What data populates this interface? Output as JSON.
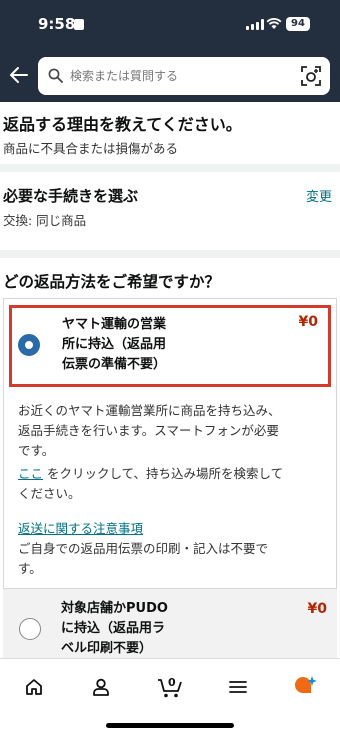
{
  "status_bar": {
    "time": "9:58",
    "battery": "94"
  },
  "search": {
    "placeholder": "検索または質問する"
  },
  "return_reason": {
    "title": "返品する理由を教えてください。",
    "value": "商品に不具合または損傷がある"
  },
  "procedure": {
    "title": "必要な手続きを選ぶ",
    "change_label": "変更",
    "value": "交換: 同じ商品"
  },
  "return_method": {
    "title": "どの返品方法をご希望ですか？",
    "options": [
      {
        "label": "ヤマト運輸の営業所に持込（返品用伝票の準備不要）",
        "label_lines": [
          "ヤマト運輸の営業",
          "所に持込（返品用",
          "伝票の準備不要）"
        ],
        "price": "¥0",
        "selected": true,
        "description": "お近くのヤマト運輸営業所に商品を持ち込み、返品手続きを行います。スマートフォンが必要です。",
        "description_lines": [
          "お近くのヤマト運輸営業所に商品を持ち込み、",
          "返品手続きを行います。スマートフォンが必要",
          "です。"
        ],
        "search_link": "ここ",
        "search_text_line1": " をクリックして、持ち込み場所を検索して",
        "search_text_line2": "ください。",
        "notice_link": "返送に関する注意事項",
        "notice_lines": [
          "ご自身での返品用伝票の印刷・記入は不要で",
          "す。"
        ]
      },
      {
        "label": "対象店舗かPUDOに持込（返品用ラベル印刷不要）",
        "label_lines": [
          "対象店舗かPUDO",
          "に持込（返品用ラ",
          "ベル印刷不要）"
        ],
        "price": "¥0",
        "selected": false
      }
    ]
  },
  "tab_bar": {
    "cart_count": "0",
    "items": [
      "home-icon",
      "account-icon",
      "cart-icon",
      "menu-icon",
      "rufus-icon"
    ]
  }
}
